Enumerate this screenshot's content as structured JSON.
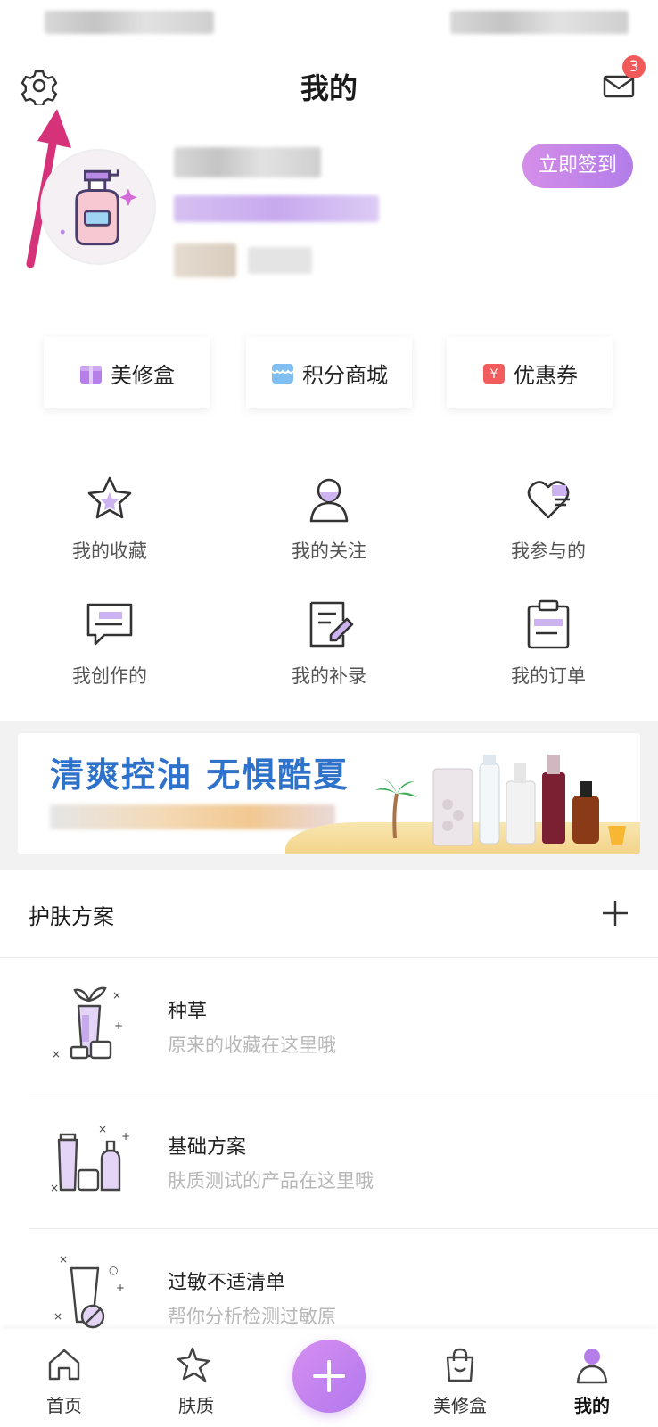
{
  "header": {
    "title": "我的",
    "mail_badge": "3"
  },
  "profile": {
    "checkin_label": "立即签到"
  },
  "quick_links": [
    {
      "label": "美修盒",
      "icon": "gift-box-icon",
      "color": "#b57ee8"
    },
    {
      "label": "积分商城",
      "icon": "store-icon",
      "color": "#4fa3e8"
    },
    {
      "label": "优惠券",
      "icon": "coupon-icon",
      "color": "#f25c5c"
    }
  ],
  "grid": [
    {
      "label": "我的收藏",
      "icon": "star-icon"
    },
    {
      "label": "我的关注",
      "icon": "person-icon"
    },
    {
      "label": "我参与的",
      "icon": "heart-icon"
    },
    {
      "label": "我创作的",
      "icon": "chat-icon"
    },
    {
      "label": "我的补录",
      "icon": "edit-doc-icon"
    },
    {
      "label": "我的订单",
      "icon": "clipboard-icon"
    }
  ],
  "banner": {
    "title": "清爽控油 无惧酷夏"
  },
  "skincare": {
    "section_title": "护肤方案",
    "items": [
      {
        "title": "种草",
        "desc": "原来的收藏在这里哦",
        "icon": "plant-bottle-icon"
      },
      {
        "title": "基础方案",
        "desc": "肤质测试的产品在这里哦",
        "icon": "skincare-set-icon"
      },
      {
        "title": "过敏不适清单",
        "desc": "帮你分析检测过敏原",
        "icon": "allergy-icon"
      }
    ]
  },
  "tabbar": [
    {
      "label": "首页",
      "icon": "home-icon"
    },
    {
      "label": "肤质",
      "icon": "sparkle-icon"
    },
    {
      "label": "美修盒",
      "icon": "shopping-bag-icon"
    },
    {
      "label": "我的",
      "icon": "user-icon",
      "active": true
    }
  ],
  "colors": {
    "accent": "#b57ee8",
    "banner_title": "#2f72c9",
    "badge": "#f05a5a",
    "arrow": "#d6327a"
  }
}
